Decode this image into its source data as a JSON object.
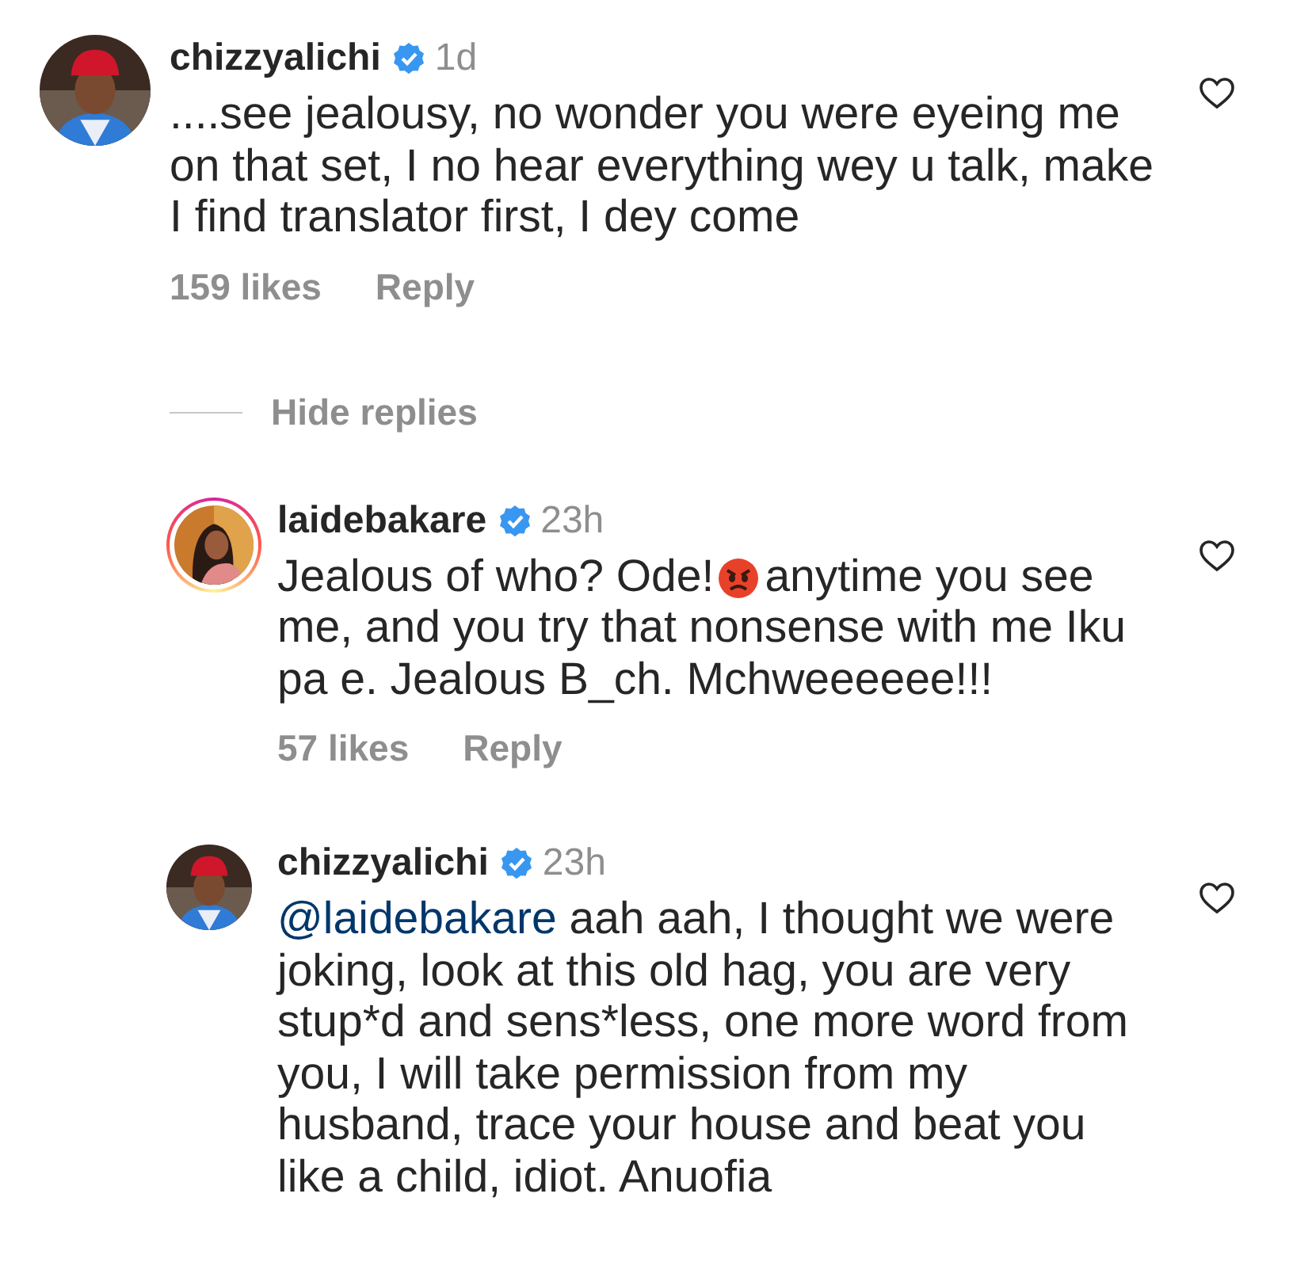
{
  "comment": {
    "username": "chizzyalichi",
    "verified": true,
    "time": "1d",
    "story_ring": false,
    "liked": false,
    "body": [
      {
        "kind": "text",
        "text": "....see jealousy, no wonder you were eyeing me on that set, I no hear everything wey u talk, make I find translator first, I dey come"
      }
    ],
    "likes": "159 likes",
    "reply": "Reply"
  },
  "replies_toggle": "Hide replies",
  "replies": [
    {
      "username": "laidebakare",
      "verified": true,
      "time": "23h",
      "story_ring": true,
      "liked": false,
      "body": [
        {
          "kind": "text",
          "text": "Jealous of who? Ode!"
        },
        {
          "kind": "emoji"
        },
        {
          "kind": "text",
          "text": "anytime you see me, and you try that nonsense with me Iku pa e. Jealous B_ch. Mchweeeeee!!!"
        }
      ],
      "likes": "57 likes",
      "reply": "Reply"
    },
    {
      "username": "chizzyalichi",
      "verified": true,
      "time": "23h",
      "story_ring": false,
      "liked": false,
      "body": [
        {
          "kind": "mention",
          "text": "@laidebakare"
        },
        {
          "kind": "text",
          "text": " aah aah, I thought we were joking, look at this old hag, you are very stup*d and sens*less, one more word from you, I will take permission from my husband, trace your house and beat you like a child, idiot. Anuofia"
        }
      ]
    }
  ]
}
